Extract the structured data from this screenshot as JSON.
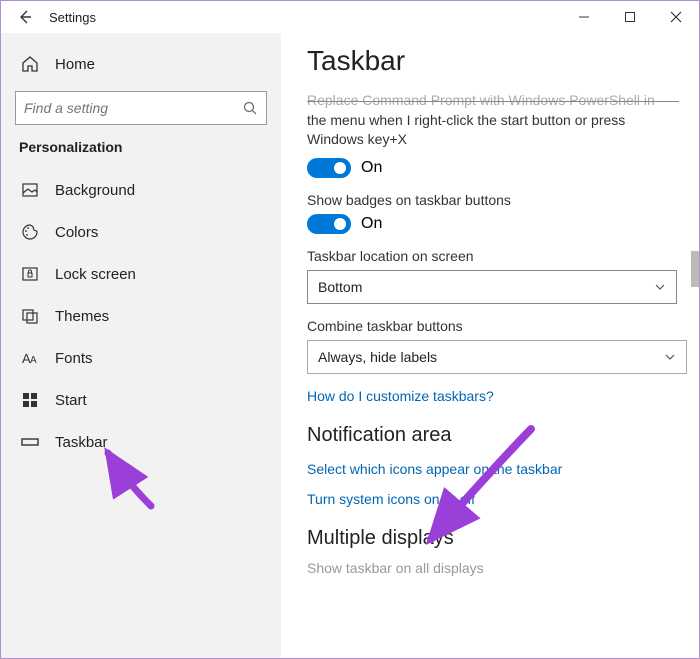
{
  "titlebar": {
    "title": "Settings"
  },
  "sidebar": {
    "home": "Home",
    "search_placeholder": "Find a setting",
    "section": "Personalization",
    "items": [
      {
        "label": "Background"
      },
      {
        "label": "Colors"
      },
      {
        "label": "Lock screen"
      },
      {
        "label": "Themes"
      },
      {
        "label": "Fonts"
      },
      {
        "label": "Start"
      },
      {
        "label": "Taskbar"
      }
    ]
  },
  "main": {
    "heading": "Taskbar",
    "replace_cmd_line1": "Replace Command Prompt with Windows PowerShell in",
    "replace_cmd_line2": "the menu when I right-click the start button or press Windows key+X",
    "toggle_on": "On",
    "badges_label": "Show badges on taskbar buttons",
    "location_label": "Taskbar location on screen",
    "location_value": "Bottom",
    "combine_label": "Combine taskbar buttons",
    "combine_value": "Always, hide labels",
    "help_link": "How do I customize taskbars?",
    "notif_heading": "Notification area",
    "notif_link1": "Select which icons appear on the taskbar",
    "notif_link2": "Turn system icons on or off",
    "multi_heading": "Multiple displays",
    "multi_faded": "Show taskbar on all displays"
  }
}
